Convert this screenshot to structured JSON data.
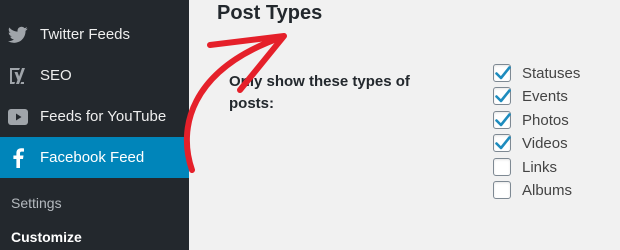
{
  "sidebar": {
    "items": [
      {
        "label": "Twitter Feeds",
        "icon": "twitter-bird-icon"
      },
      {
        "label": "SEO",
        "icon": "yoast-icon"
      },
      {
        "label": "Feeds for YouTube",
        "icon": "youtube-play-icon"
      },
      {
        "label": "Facebook Feed",
        "icon": "facebook-f-icon",
        "current": true
      }
    ],
    "submenu": [
      {
        "label": "Settings"
      },
      {
        "label": "Customize",
        "current": true
      }
    ]
  },
  "main": {
    "section_title": "Post Types",
    "row_label": "Only show these types of posts:",
    "options": [
      {
        "label": "Statuses",
        "checked": true
      },
      {
        "label": "Events",
        "checked": true
      },
      {
        "label": "Photos",
        "checked": true
      },
      {
        "label": "Videos",
        "checked": true
      },
      {
        "label": "Links",
        "checked": false
      },
      {
        "label": "Albums",
        "checked": false
      }
    ]
  },
  "colors": {
    "sidebar_bg": "#23282d",
    "current_bg": "#0085ba",
    "checkmark": "#1e8cbe",
    "annotation_arrow": "#e5202a"
  }
}
